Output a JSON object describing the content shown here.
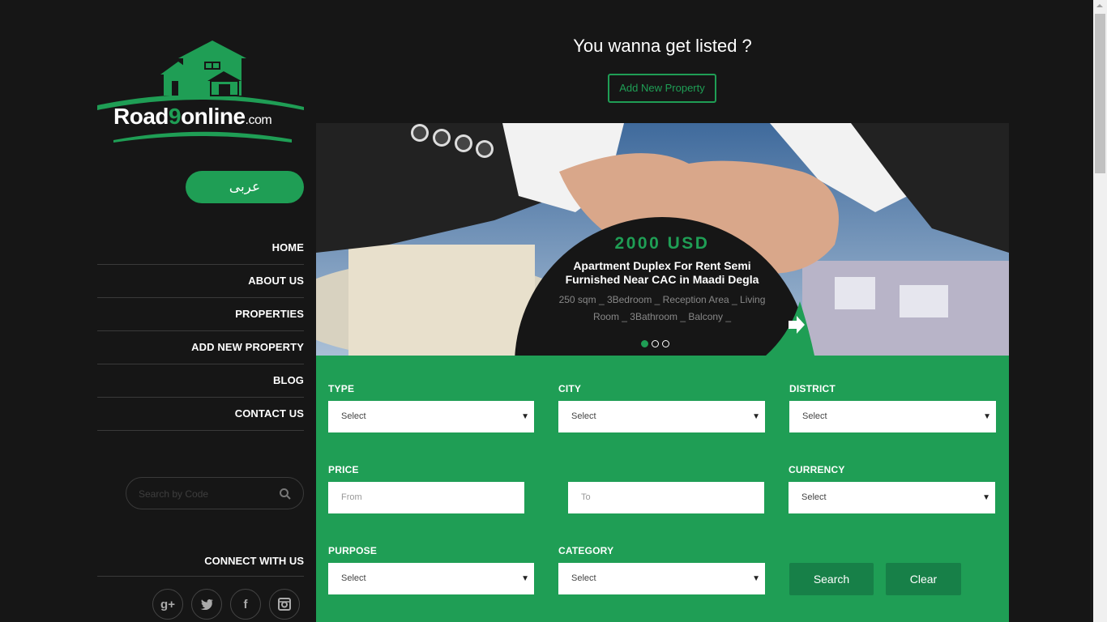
{
  "brand": {
    "name_part1": "Road",
    "name_digit": "9",
    "name_part2": "online",
    "name_tld": ".com"
  },
  "lang_button": "عربى",
  "nav": [
    "HOME",
    "ABOUT US",
    "PROPERTIES",
    "ADD NEW PROPERTY",
    "BLOG",
    "CONTACT US"
  ],
  "search_code": {
    "placeholder": "Search by Code"
  },
  "connect_label": "CONNECT WITH US",
  "socials": [
    {
      "icon": "google-plus-icon",
      "glyph": "g+"
    },
    {
      "icon": "twitter-icon",
      "glyph": "🐦"
    },
    {
      "icon": "facebook-icon",
      "glyph": "f"
    },
    {
      "icon": "instagram-icon",
      "glyph": "◙"
    }
  ],
  "header": {
    "headline": "You wanna get listed ?",
    "add_button": "Add New Property"
  },
  "slider": {
    "price": "2000 USD",
    "title": "Apartment Duplex For Rent Semi Furnished Near CAC in Maadi Degla",
    "description": "250 sqm _ 3Bedroom _ Reception Area _ Living Room _ 3Bathroom _ Balcony _",
    "slide_count": 3,
    "active_slide": 1
  },
  "search_form": {
    "type": {
      "label": "TYPE",
      "value": "Select"
    },
    "city": {
      "label": "CITY",
      "value": "Select"
    },
    "district": {
      "label": "DISTRICT",
      "value": "Select"
    },
    "price": {
      "label": "PRICE",
      "from_placeholder": "From",
      "to_placeholder": "To"
    },
    "currency": {
      "label": "CURRENCY",
      "value": "Select"
    },
    "purpose": {
      "label": "PURPOSE",
      "value": "Select"
    },
    "category": {
      "label": "CATEGORY",
      "value": "Select"
    },
    "search_button": "Search",
    "clear_button": "Clear"
  },
  "colors": {
    "accent": "#1f9e55",
    "background": "#161616",
    "button_dark": "#178048"
  }
}
